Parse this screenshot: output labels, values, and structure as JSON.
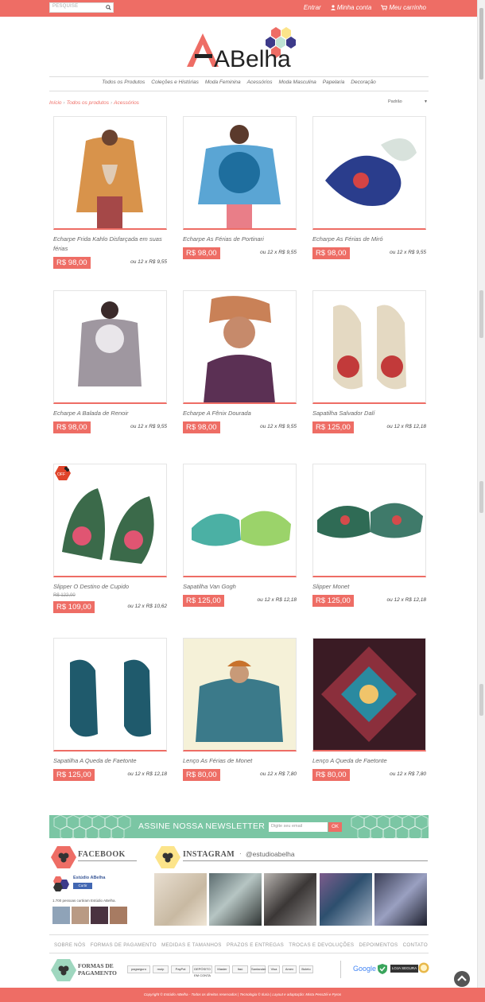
{
  "topbar": {
    "search_placeholder": "PESQUISE",
    "links": [
      {
        "label": "Entrar",
        "icon": ""
      },
      {
        "label": "Minha conta",
        "icon": "user-icon"
      },
      {
        "label": "Meu carrinho",
        "icon": "cart-icon"
      }
    ]
  },
  "logo": {
    "text": "ABelha"
  },
  "nav": {
    "items": [
      "Todos os Produtos",
      "Coleções e Histórias",
      "Moda Feminina",
      "Acessórios",
      "Moda Masculina",
      "Papelaria",
      "Decoração"
    ]
  },
  "breadcrumb": [
    "Início",
    "Todos os produtos",
    "Acessórios"
  ],
  "sort": {
    "selected": "Padrão"
  },
  "products": [
    {
      "name": "Echarpe Frida Kahlo Disfarçada em suas férias",
      "price": "R$ 98,00",
      "installment": "ou 12 x R$ 9,55",
      "old_price": "",
      "offer": false
    },
    {
      "name": "Echarpe As Férias de Portinari",
      "price": "R$ 98,00",
      "installment": "ou 12 x R$ 9,55",
      "old_price": "",
      "offer": false
    },
    {
      "name": "Echarpe As Férias de Miró",
      "price": "R$ 98,00",
      "installment": "ou 12 x R$ 9,55",
      "old_price": "",
      "offer": false
    },
    {
      "name": "Echarpe A Balada de Renoir",
      "price": "R$ 98,00",
      "installment": "ou 12 x R$ 9,55",
      "old_price": "",
      "offer": false
    },
    {
      "name": "Echarpe A Fênix Dourada",
      "price": "R$ 98,00",
      "installment": "ou 12 x R$ 9,55",
      "old_price": "",
      "offer": false
    },
    {
      "name": "Sapatilha Salvador Dalí",
      "price": "R$ 125,00",
      "installment": "ou 12 x R$ 12,18",
      "old_price": "",
      "offer": false
    },
    {
      "name": "Slipper O Destino de Cupido",
      "price": "R$ 109,00",
      "installment": "ou 12 x R$ 10,62",
      "old_price": "R$ 122,00",
      "offer": true
    },
    {
      "name": "Sapatilha Van Gogh",
      "price": "R$ 125,00",
      "installment": "ou 12 x R$ 12,18",
      "old_price": "",
      "offer": false
    },
    {
      "name": "Slipper Monet",
      "price": "R$ 125,00",
      "installment": "ou 12 x R$ 12,18",
      "old_price": "",
      "offer": false
    },
    {
      "name": "Sapatilha A Queda de Faetonte",
      "price": "R$ 125,00",
      "installment": "ou 12 x R$ 12,18",
      "old_price": "",
      "offer": false
    },
    {
      "name": "Lenço As Férias de Monet",
      "price": "R$ 80,00",
      "installment": "ou 12 x R$ 7,80",
      "old_price": "",
      "offer": false
    },
    {
      "name": "Lenço A Queda de Faetonte",
      "price": "R$ 80,00",
      "installment": "ou 12 x R$ 7,80",
      "old_price": "",
      "offer": false
    }
  ],
  "offer_badge": "OFF",
  "newsletter": {
    "title": "ASSINE NOSSA NEWSLETTER",
    "placeholder": "Digite seu email",
    "button": "OK"
  },
  "facebook": {
    "title": "FACEBOOK",
    "page_name": "Estúdio ABelha",
    "like_button": "Curtir",
    "count_text": "1.700 pessoas curtiram Estúdio ABelha."
  },
  "instagram": {
    "title": "INSTAGRAM",
    "handle": "@estudioabelha"
  },
  "footer_links": [
    "SOBRE NÓS",
    "FORMAS DE PAGAMENTO",
    "MEDIDAS E TAMANHOS",
    "PRAZOS E ENTREGAS",
    "TROCAS E DEVOLUÇÕES",
    "DEPOIMENTOS",
    "CONTATO"
  ],
  "payment": {
    "title_line1": "FORMAS DE",
    "title_line2": "PAGAMENTO",
    "methods": [
      "pagseguro",
      "moip",
      "PayPal",
      "DEPÓSITO EM CONTA",
      "Master",
      "Itaú",
      "Santander",
      "Visa",
      "Amex",
      "Boleto"
    ],
    "google_label": "Google",
    "secure_label": "LOJA SEGURA"
  },
  "copyright": "Copyright © Estúdio ABelha - Todos os direitos reservados | Tecnologia © Iluria | Layout e adaptação: Mista PessZéi e Pyros",
  "colors": {
    "accent": "#ee6d65",
    "newsletter_bg": "#7bc6a4"
  }
}
